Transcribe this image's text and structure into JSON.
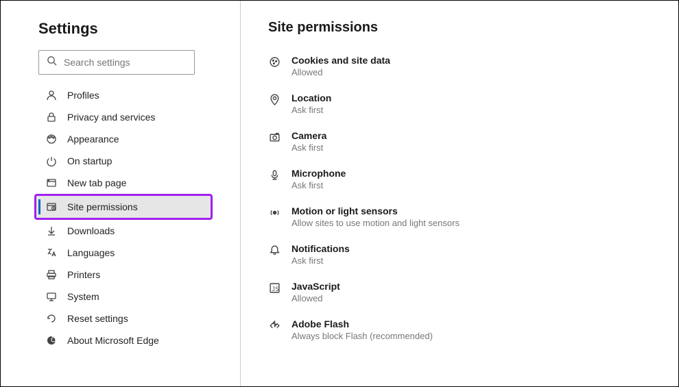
{
  "sidebar": {
    "title": "Settings",
    "search_placeholder": "Search settings",
    "items": [
      {
        "label": "Profiles"
      },
      {
        "label": "Privacy and services"
      },
      {
        "label": "Appearance"
      },
      {
        "label": "On startup"
      },
      {
        "label": "New tab page"
      },
      {
        "label": "Site permissions"
      },
      {
        "label": "Downloads"
      },
      {
        "label": "Languages"
      },
      {
        "label": "Printers"
      },
      {
        "label": "System"
      },
      {
        "label": "Reset settings"
      },
      {
        "label": "About Microsoft Edge"
      }
    ]
  },
  "main": {
    "title": "Site permissions",
    "permissions": [
      {
        "title": "Cookies and site data",
        "sub": "Allowed"
      },
      {
        "title": "Location",
        "sub": "Ask first"
      },
      {
        "title": "Camera",
        "sub": "Ask first"
      },
      {
        "title": "Microphone",
        "sub": "Ask first"
      },
      {
        "title": "Motion or light sensors",
        "sub": "Allow sites to use motion and light sensors"
      },
      {
        "title": "Notifications",
        "sub": "Ask first"
      },
      {
        "title": "JavaScript",
        "sub": "Allowed"
      },
      {
        "title": "Adobe Flash",
        "sub": "Always block Flash (recommended)"
      }
    ]
  }
}
